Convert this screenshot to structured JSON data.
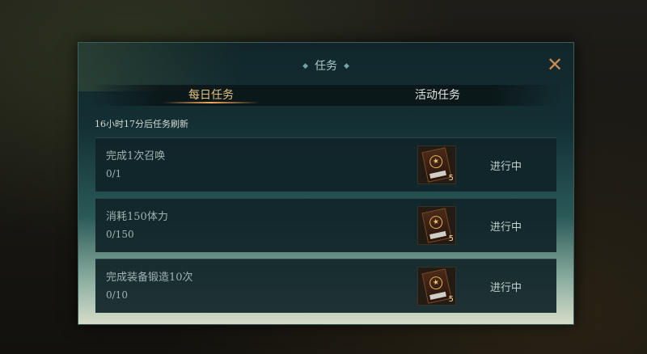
{
  "dialog": {
    "title": "任务",
    "close_icon": "close-x-icon"
  },
  "tabs": [
    {
      "label": "每日任务",
      "active": true
    },
    {
      "label": "活动任务",
      "active": false
    }
  ],
  "refresh_text": "16小时17分后任务刷新",
  "tasks": [
    {
      "name": "完成1次召唤",
      "progress": "0/1",
      "reward_icon": "summon-card-icon",
      "reward_count": "5",
      "status": "进行中"
    },
    {
      "name": "消耗150体力",
      "progress": "0/150",
      "reward_icon": "summon-card-icon",
      "reward_count": "5",
      "status": "进行中"
    },
    {
      "name": "完成装备锻造10次",
      "progress": "0/10",
      "reward_icon": "summon-card-icon",
      "reward_count": "5",
      "status": "进行中"
    }
  ],
  "colors": {
    "accent_tab": "#e8c37e",
    "close": "#c98a54",
    "panel_top": "#10262a",
    "panel_bottom": "#d6dcc8"
  }
}
